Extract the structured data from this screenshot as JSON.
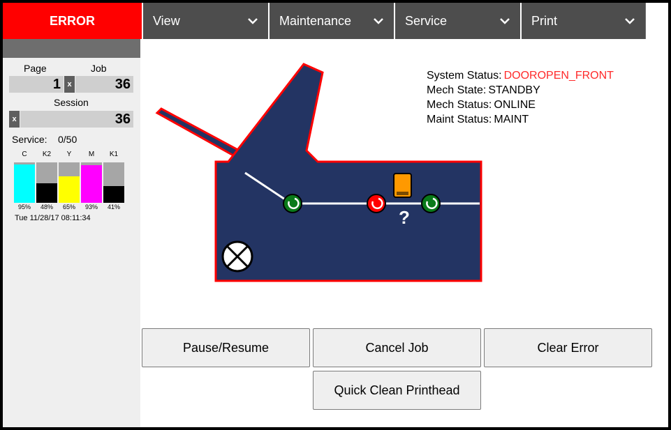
{
  "header": {
    "status_tab": "ERROR",
    "menus": [
      {
        "label": "View"
      },
      {
        "label": "Maintenance"
      },
      {
        "label": "Service"
      },
      {
        "label": "Print"
      }
    ]
  },
  "counters": {
    "page_label": "Page",
    "job_label": "Job",
    "page_value": "1",
    "job_value": "36",
    "reset_glyph": "x",
    "session_label": "Session",
    "session_value": "36"
  },
  "service": {
    "label": "Service:",
    "value": "0/50"
  },
  "inks": [
    {
      "name": "C",
      "percent_label": "95%",
      "level": 0.95,
      "color": "#00ffff"
    },
    {
      "name": "K2",
      "percent_label": "48%",
      "level": 0.48,
      "color": "#000000"
    },
    {
      "name": "Y",
      "percent_label": "65%",
      "level": 0.65,
      "color": "#ffff00"
    },
    {
      "name": "M",
      "percent_label": "93%",
      "level": 0.93,
      "color": "#ff00ff"
    },
    {
      "name": "K1",
      "percent_label": "41%",
      "level": 0.41,
      "color": "#000000"
    }
  ],
  "timestamp": "Tue 11/28/17 08:11:34",
  "system_status": [
    {
      "key": "System Status:",
      "value": "DOOROPEN_FRONT",
      "alert": true
    },
    {
      "key": "Mech State:",
      "value": "STANDBY",
      "alert": false
    },
    {
      "key": "Mech Status:",
      "value": "ONLINE",
      "alert": false
    },
    {
      "key": "Maint Status:",
      "value": "MAINT",
      "alert": false
    }
  ],
  "diagram": {
    "unknown_glyph": "?",
    "colors": {
      "body": "#233463",
      "outline": "#ff0000",
      "ok_sensor": "#0a7a1a",
      "error_sensor": "#ff0000",
      "cartridge": "#ff9900"
    }
  },
  "actions": {
    "pause_resume": "Pause/Resume",
    "cancel_job": "Cancel Job",
    "clear_error": "Clear Error",
    "quick_clean": "Quick Clean Printhead"
  }
}
